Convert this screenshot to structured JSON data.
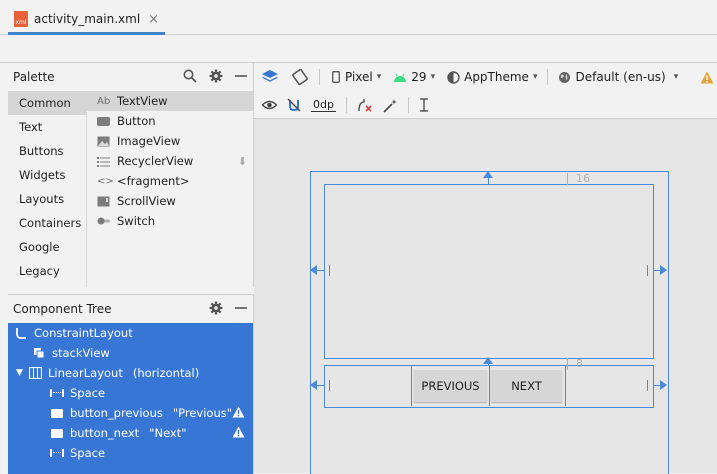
{
  "tab": {
    "file_name": "activity_main.xml",
    "file_type": "xml",
    "close_glyph": "×"
  },
  "palette": {
    "title": "Palette",
    "categories": [
      "Common",
      "Text",
      "Buttons",
      "Widgets",
      "Layouts",
      "Containers",
      "Google",
      "Legacy"
    ],
    "selected_category": "Common",
    "items": [
      {
        "icon": "Ab",
        "label": "TextView"
      },
      {
        "icon": "button-icon",
        "label": "Button"
      },
      {
        "icon": "image-icon",
        "label": "ImageView"
      },
      {
        "icon": "list-icon",
        "label": "RecyclerView"
      },
      {
        "icon": "<>",
        "label": "<fragment>"
      },
      {
        "icon": "scroll-icon",
        "label": "ScrollView"
      },
      {
        "icon": "switch-icon",
        "label": "Switch"
      }
    ]
  },
  "component_tree": {
    "title": "Component Tree",
    "items": [
      {
        "name": "ConstraintLayout",
        "attr": "",
        "warning": false
      },
      {
        "name": "stackView",
        "attr": "",
        "warning": false
      },
      {
        "name": "LinearLayout",
        "attr": "(horizontal)",
        "warning": false
      },
      {
        "name": "Space",
        "attr": "",
        "warning": false
      },
      {
        "name": "button_previous",
        "attr": "\"Previous\"",
        "warning": true
      },
      {
        "name": "button_next",
        "attr": "\"Next\"",
        "warning": true
      },
      {
        "name": "Space",
        "attr": "",
        "warning": false
      }
    ]
  },
  "toolbar": {
    "device": "Pixel",
    "api": "29",
    "theme": "AppTheme",
    "locale": "Default (en-us)",
    "margin": "0dp"
  },
  "canvas": {
    "margin_top_stack": "16",
    "margin_top_linear": "8",
    "button_previous_label": "PREVIOUS",
    "button_next_label": "NEXT"
  },
  "colors": {
    "selection": "#3876d6",
    "constraint": "#4a89dc",
    "tab_underline": "#4083c9",
    "warning": "#e8a33d"
  }
}
